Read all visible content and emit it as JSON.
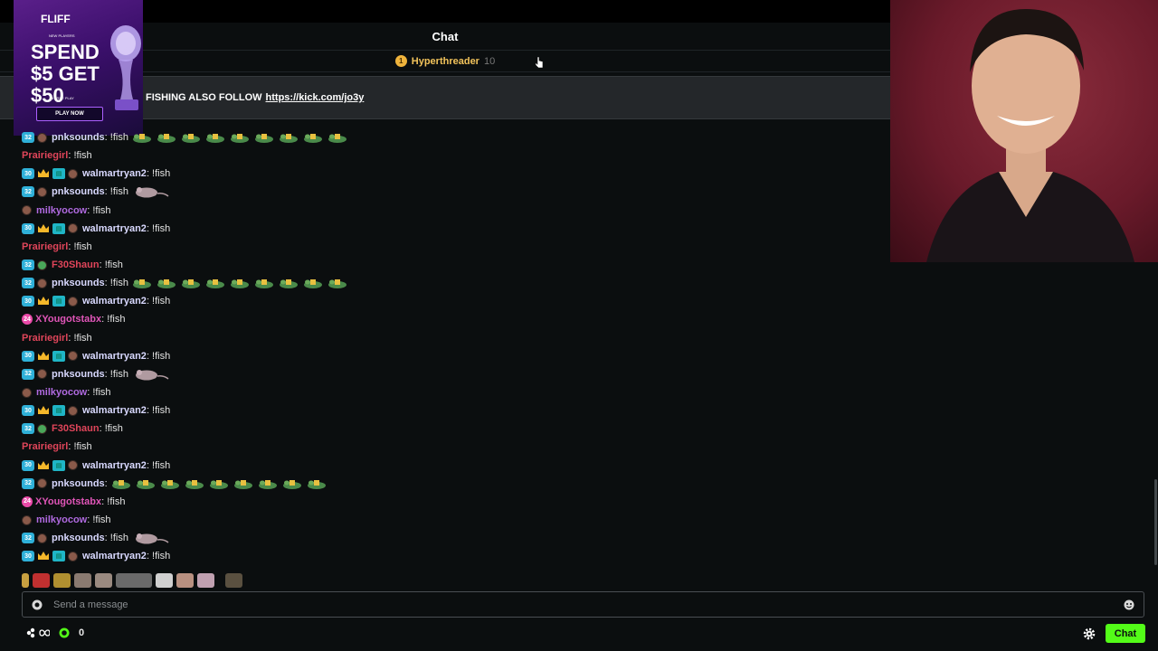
{
  "header": {
    "title": "Chat"
  },
  "leaderboard": {
    "rank": "1",
    "name": "Hyperthreader",
    "count": "10"
  },
  "pinned": {
    "text": "FISHING ALSO FOLLOW",
    "link": "https://kick.com/jo3y"
  },
  "ad": {
    "brand": "FLIFF",
    "tag": "NEW PLAYERS",
    "headline": "SPEND $5 GET $50",
    "sub": "IN FREE PLAY",
    "cta": "PLAY NOW"
  },
  "colors": {
    "pnksounds": "#d9d9ff",
    "walmartryan2": "#d9d9ff",
    "prairiegirl": "#e0455a",
    "milkyocow": "#b06ae0",
    "f30shaun": "#e0455a",
    "xyougotstabx": "#e055b8",
    "kick_green": "#53fc18"
  },
  "messages": [
    {
      "user": "pnksounds",
      "sep": ":",
      "text": " !fish",
      "badges": [
        "32"
      ],
      "avatar": "brown",
      "extra": "frogs"
    },
    {
      "user": "Prairiegirl",
      "sep": ":",
      "text": " !fish",
      "badges": [],
      "avatar": "",
      "extra": ""
    },
    {
      "user": "walmartryan2",
      "sep": ":",
      "text": " !fish",
      "badges": [
        "30",
        "crown",
        "gift"
      ],
      "avatar": "brown",
      "extra": ""
    },
    {
      "user": "pnksounds",
      "sep": ":",
      "text": " !fish",
      "badges": [
        "32"
      ],
      "avatar": "brown",
      "extra": "rat"
    },
    {
      "user": "milkyocow",
      "sep": ":",
      "text": " !fish",
      "badges": [],
      "avatar": "brown",
      "extra": ""
    },
    {
      "user": "walmartryan2",
      "sep": ":",
      "text": " !fish",
      "badges": [
        "30",
        "crown",
        "gift"
      ],
      "avatar": "brown",
      "extra": ""
    },
    {
      "user": "Prairiegirl",
      "sep": ":",
      "text": " !fish",
      "badges": [],
      "avatar": "",
      "extra": ""
    },
    {
      "user": "F30Shaun",
      "sep": ":",
      "text": " !fish",
      "badges": [
        "32"
      ],
      "avatar": "green",
      "extra": ""
    },
    {
      "user": "pnksounds",
      "sep": ":",
      "text": " !fish",
      "badges": [
        "32"
      ],
      "avatar": "brown",
      "extra": "frogs"
    },
    {
      "user": "walmartryan2",
      "sep": ":",
      "text": " !fish",
      "badges": [
        "30",
        "crown",
        "gift"
      ],
      "avatar": "brown",
      "extra": ""
    },
    {
      "user": "XYougotstabx",
      "sep": ":",
      "text": " !fish",
      "badges": [
        "pink"
      ],
      "avatar": "",
      "extra": ""
    },
    {
      "user": "Prairiegirl",
      "sep": ":",
      "text": " !fish",
      "badges": [],
      "avatar": "",
      "extra": ""
    },
    {
      "user": "walmartryan2",
      "sep": ":",
      "text": " !fish",
      "badges": [
        "30",
        "crown",
        "gift"
      ],
      "avatar": "brown",
      "extra": ""
    },
    {
      "user": "pnksounds",
      "sep": ":",
      "text": " !fish",
      "badges": [
        "32"
      ],
      "avatar": "brown",
      "extra": "rat"
    },
    {
      "user": "milkyocow",
      "sep": ":",
      "text": " !fish",
      "badges": [],
      "avatar": "brown",
      "extra": ""
    },
    {
      "user": "walmartryan2",
      "sep": ":",
      "text": " !fish",
      "badges": [
        "30",
        "crown",
        "gift"
      ],
      "avatar": "brown",
      "extra": ""
    },
    {
      "user": "F30Shaun",
      "sep": ":",
      "text": " !fish",
      "badges": [
        "32"
      ],
      "avatar": "green",
      "extra": ""
    },
    {
      "user": "Prairiegirl",
      "sep": ":",
      "text": " !fish",
      "badges": [],
      "avatar": "",
      "extra": ""
    },
    {
      "user": "walmartryan2",
      "sep": ":",
      "text": " !fish",
      "badges": [
        "30",
        "crown",
        "gift"
      ],
      "avatar": "brown",
      "extra": ""
    },
    {
      "user": "pnksounds",
      "sep": ":",
      "text": "",
      "badges": [
        "32"
      ],
      "avatar": "brown",
      "extra": "frogs"
    },
    {
      "user": "XYougotstabx",
      "sep": ":",
      "text": " !fish",
      "badges": [
        "pink"
      ],
      "avatar": "",
      "extra": ""
    },
    {
      "user": "milkyocow",
      "sep": ":",
      "text": " !fish",
      "badges": [],
      "avatar": "brown",
      "extra": ""
    },
    {
      "user": "pnksounds",
      "sep": ":",
      "text": " !fish",
      "badges": [
        "32"
      ],
      "avatar": "brown",
      "extra": "rat"
    },
    {
      "user": "walmartryan2",
      "sep": ":",
      "text": " !fish",
      "badges": [
        "30",
        "crown",
        "gift"
      ],
      "avatar": "brown",
      "extra": ""
    }
  ],
  "input": {
    "placeholder": "Send a message"
  },
  "footer": {
    "count": "0",
    "chat_button": "Chat"
  }
}
